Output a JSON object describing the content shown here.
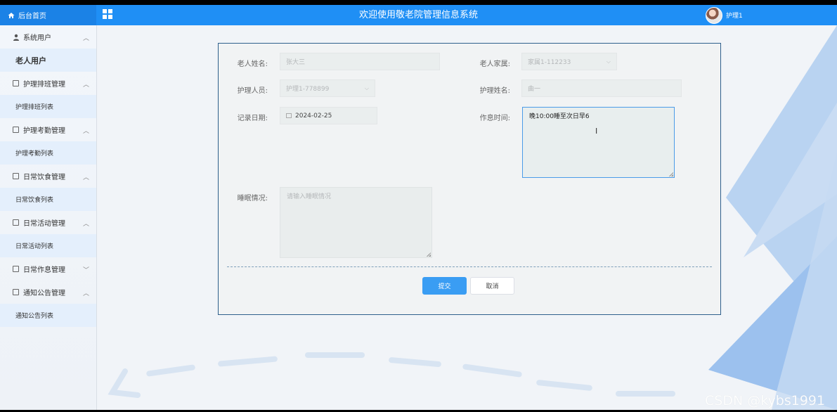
{
  "app": {
    "title": "欢迎使用敬老院管理信息系统",
    "home_label": "后台首页",
    "user_name": "护理1"
  },
  "sidebar": {
    "items": [
      {
        "type": "group",
        "label": "系统用户",
        "icon": "user-icon",
        "expanded": true
      },
      {
        "type": "sub",
        "label": "老人用户",
        "active": true
      },
      {
        "type": "group",
        "label": "护理排班管理",
        "icon": "edit-icon",
        "expanded": true
      },
      {
        "type": "sub",
        "label": "护理排班列表"
      },
      {
        "type": "group",
        "label": "护理考勤管理",
        "icon": "edit-icon",
        "expanded": true
      },
      {
        "type": "sub",
        "label": "护理考勤列表"
      },
      {
        "type": "group",
        "label": "日常饮食管理",
        "icon": "edit-icon",
        "expanded": true
      },
      {
        "type": "sub",
        "label": "日常饮食列表"
      },
      {
        "type": "group",
        "label": "日常活动管理",
        "icon": "edit-icon",
        "expanded": true
      },
      {
        "type": "sub",
        "label": "日常活动列表"
      },
      {
        "type": "group",
        "label": "日常作息管理",
        "icon": "edit-icon",
        "expanded": false
      },
      {
        "type": "group",
        "label": "通知公告管理",
        "icon": "edit-icon",
        "expanded": true
      },
      {
        "type": "sub",
        "label": "通知公告列表"
      }
    ]
  },
  "form": {
    "elder_name": {
      "label": "老人姓名:",
      "value": "张大三"
    },
    "elder_family": {
      "label": "老人家属:",
      "value": "家属1-112233"
    },
    "nurse": {
      "label": "护理人员:",
      "value": "护理1-778899"
    },
    "nurse_name": {
      "label": "护理姓名:",
      "value": "曲一"
    },
    "record_date": {
      "label": "记录日期:",
      "value": "2024-02-25"
    },
    "schedule_time": {
      "label": "作息时间:",
      "value": "晚10:00睡至次日早6"
    },
    "sleep": {
      "label": "睡眠情况:",
      "placeholder": "请输入睡眠情况"
    },
    "submit_label": "提交",
    "cancel_label": "取消"
  },
  "watermark": "CSDN @kybs1991",
  "colors": {
    "topbar": "#1f8ff5",
    "primary_button": "#3a9df3",
    "card_border": "#2e5f8c"
  }
}
